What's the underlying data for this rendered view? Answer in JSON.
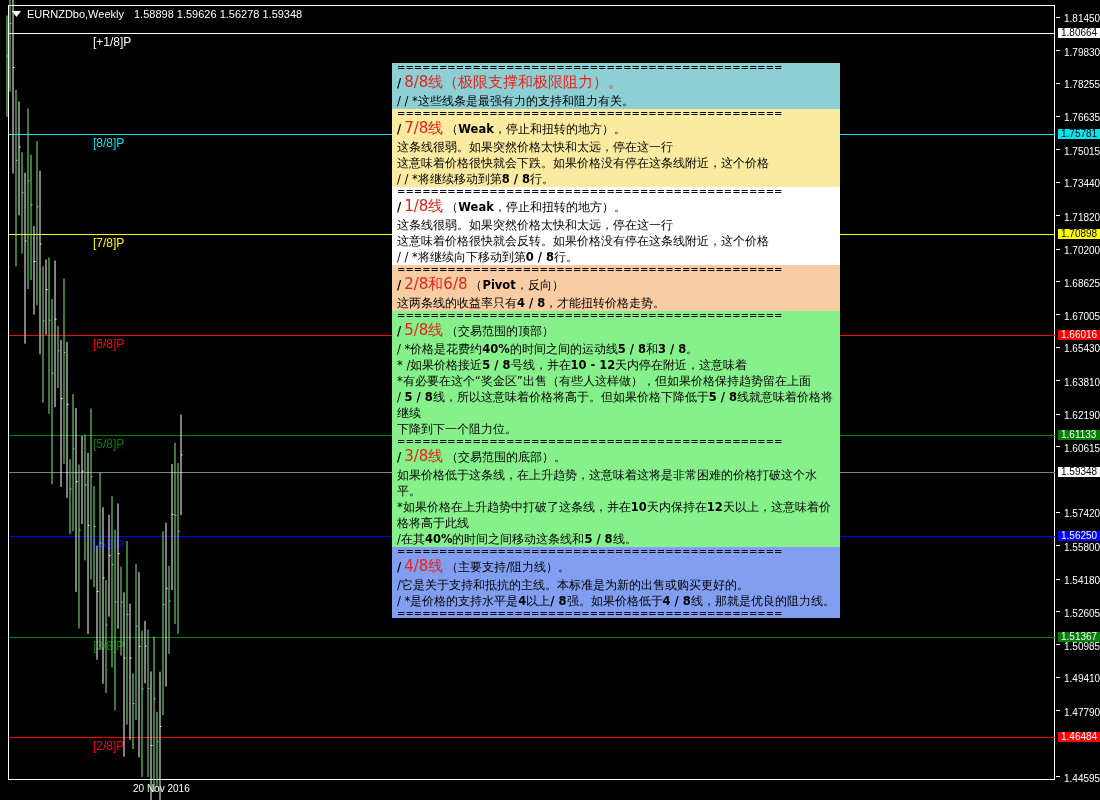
{
  "chart": {
    "header": {
      "symbol": "EURNZDbo,Weekly",
      "ohlc": "1.58898 1.59626 1.56278 1.59348"
    },
    "levels": [
      {
        "label": "[+1/8]P",
        "price": "1.80664",
        "color": "#ffffff"
      },
      {
        "label": "[8/8]P",
        "price": "1.75781",
        "color": "#00e5ee"
      },
      {
        "label": "[7/8]P",
        "price": "1.70898",
        "color": "#ffff00"
      },
      {
        "label": "[6/8]P",
        "price": "1.66016",
        "color": "#ff0000"
      },
      {
        "label": "[5/8]P",
        "price": "1.61133",
        "color": "#008000"
      },
      {
        "label": "[4/8]P",
        "price": "1.56250",
        "color": "#0000ff"
      },
      {
        "label": "[3/8]P",
        "price": "1.51367",
        "color": "#008000"
      },
      {
        "label": "[2/8]P",
        "price": "1.46484",
        "color": "#ff0000"
      }
    ],
    "current_price": "1.59348",
    "price_ticks": [
      "1.81450",
      "1.79830",
      "1.78255",
      "1.76635",
      "1.75015",
      "1.73440",
      "1.71820",
      "1.70200",
      "1.68625",
      "1.67005",
      "1.65430",
      "1.63810",
      "1.62190",
      "1.60615",
      "1.57420",
      "1.55800",
      "1.54180",
      "1.52605",
      "1.50985",
      "1.49410",
      "1.47790",
      "1.44595"
    ],
    "date_labels": [
      "20 Nov 2016"
    ]
  },
  "notes": {
    "separator": "==============================================",
    "sections": [
      {
        "color": "#8ccfd5",
        "prefix": "/",
        "title": "8/8线（极限支撑和极限阻力）。",
        "lines": [
          "/ / *这些线条是最强有力的支持和阻力有关。"
        ]
      },
      {
        "color": "#fbeba0",
        "prefix": "/",
        "title": "7/8线",
        "subtitle": "（**Weak**，停止和扭转的地方）。",
        "lines": [
          "这条线很弱。如果突然价格太快和太远，停在这一行",
          "这意味着价格很快就会下跌。如果价格没有停在这条线附近，这个价格",
          "/ / *将继续移动到第**8 / 8**行。"
        ]
      },
      {
        "color": "#ffffff",
        "prefix": "/",
        "title": "1/8线",
        "subtitle": "（**Weak**，停止和扭转的地方）。",
        "lines": [
          "这条线很弱。如果突然价格太快和太远，停在这一行",
          "这意味着价格很快就会反转。如果价格没有停在这条线附近，这个价格",
          "/ / *将继续向下移动到第**0 / 8**行。"
        ]
      },
      {
        "color": "#f9cda3",
        "prefix": "/",
        "title": "2/8和6/8",
        "subtitle": "（**Pivot**，反向）",
        "lines": [
          "这两条线的收益率只有**4 / 8**，才能扭转价格走势。"
        ]
      },
      {
        "color": "#86f08a",
        "prefix": "/",
        "title": "5/8线",
        "subtitle": "（交易范围的顶部）",
        "lines": [
          "/ *价格是花费约**40%**的时间之间的运动线**5 / 8**和**3 / 8**。",
          "* /如果价格接近**5 / 8**号线，并在**10 - 12**天内停在附近，这意味着",
          "*有必要在这个“奖金区”出售（有些人这样做），但如果价格保持趋势留在上面",
          "/ **5 / 8**线，所以这意味着价格将高于。但如果价格下降低于**5 / 8**线就意味着价格将继续",
          "下降到下一个阻力位。"
        ]
      },
      {
        "color": "#86f08a",
        "prefix": "/",
        "title": "3/8线",
        "subtitle": "（交易范围的底部）。",
        "lines": [
          "如果价格低于这条线，在上升趋势，这意味着这将是非常困难的价格打破这个水平。",
          "*如果价格在上升趋势中打破了这条线，并在**10**天内保持在**12**天以上，这意味着价格将高于此线",
          "/在其**40%**的时间之间移动这条线和**5 / 8**线。"
        ]
      },
      {
        "color": "#829ef0",
        "prefix": "/",
        "title": "4/8线",
        "subtitle": "（主要支持/阻力线）。",
        "lines": [
          "/它是关于支持和抵抗的主线。本标准是为新的出售或购买更好的。",
          "/ *是价格的支持水平是**4**以上**/ 8**强。如果价格低于**4 / 8**线，那就是优良的阻力线。"
        ]
      }
    ],
    "closing_separator": "=============================================="
  }
}
